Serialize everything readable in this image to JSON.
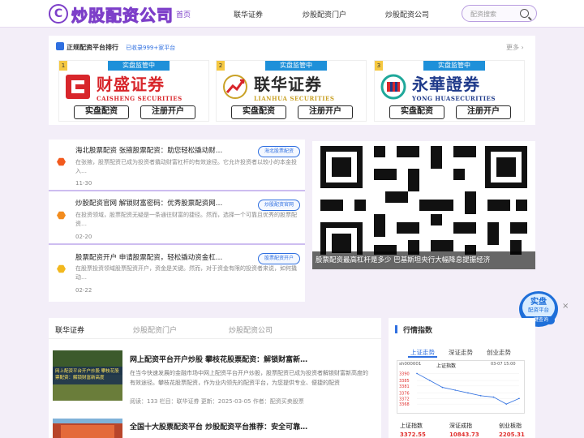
{
  "nav": {
    "logo_text": "炒股配资公司",
    "items": [
      "首页",
      "联华证券",
      "炒股配资门户",
      "炒股配资公司"
    ],
    "search_placeholder": "配资搜索"
  },
  "colors": {
    "accent": "#7d3fc9",
    "link": "#2f6fe0",
    "badge": "#1e90d9",
    "price_up": "#e0302e"
  },
  "rank": {
    "title": "正规配资平台排行",
    "subtitle": "已收录999+家平台",
    "more": "更多"
  },
  "cards": [
    {
      "num": "1",
      "tag": "实盘监管中",
      "name_cn": "财盛证券",
      "name_en": "CAISHENG SECURITIES",
      "btn1": "实盘配资",
      "btn2": "注册开户",
      "color": "#d8262b"
    },
    {
      "num": "2",
      "tag": "实盘监管中",
      "name_cn": "联华证券",
      "name_en": "LIANHUA SECURITIES",
      "btn1": "实盘配资",
      "btn2": "注册开户",
      "color": "#2a2a2a"
    },
    {
      "num": "3",
      "tag": "实盘监管中",
      "name_cn": "永華證券",
      "name_en": "YONG HUASECURITIES",
      "btn1": "实盘配资",
      "btn2": "注册开户",
      "color": "#1f3a8a"
    }
  ],
  "news": [
    {
      "title": "海北股票配资 张掖股票配资：助您轻松撬动财…",
      "desc": "在张掖，股票配资已成为投资者撬动财富杠杆的有效途径。它允许投资者以较小的本金投入…",
      "date": "11-30",
      "tag": "海北股票配资",
      "dot": "#f25a1e"
    },
    {
      "title": "炒股配资官网 解锁财富密码：优秀股票配资网…",
      "desc": "在投资领域，股票配资无疑是一条通往财富的捷径。然而，选择一个可靠且优秀的股票配资…",
      "date": "02-20",
      "tag": "炒股配资官网",
      "dot": "#f28c1e"
    },
    {
      "title": "股票配资开户 申请股票配资，轻松撬动资金杠…",
      "desc": "在股票投资领域股票配资开户，资金是关键。然而，对于资金有限的投资者来说，如何撬动…",
      "date": "02-22",
      "tag": "股票配资开户",
      "dot": "#f2b81e"
    }
  ],
  "qr_caption": "股票配资最高杠杆是多少 巴基斯坦央行大幅降息提振经济",
  "float_btn": {
    "line1": "实盘",
    "line2": "配资平台",
    "line3": "一键查询",
    "close": "×"
  },
  "tabs": [
    "联华证券",
    "炒股配资门户",
    "炒股配资公司"
  ],
  "articles": [
    {
      "title": "网上配资平台开户炒股 攀枝花股票配资：解锁财富新…",
      "desc": "在当今快速发展的金融市场中网上配资平台开户炒股，股票配资已成为投资者解锁财富新高度的有效途径。攀枝花股票配资，作为业内领先的配资平台，为您提供专业、便捷的配资",
      "meta": "阅读：133  栏目：联华证券  更新：2025-03-05  作者：配资买卖股票",
      "thumb_text": "网上配资平台开户炒股 攀枝花股票配资：解锁财富新高度"
    },
    {
      "title": "全国十大股票配资平台 炒股配资平台推荐：安全可靠…",
      "desc": "",
      "meta": "",
      "thumb_text": ""
    }
  ],
  "market": {
    "title": "行情指数",
    "tabs": [
      "上证走势",
      "深证走势",
      "创业走势"
    ],
    "chart_code": "sh000001",
    "chart_title": "上证指数",
    "chart_date": "03-07 15:00",
    "y_ticks": [
      "3390",
      "3385",
      "3381",
      "3376",
      "3372",
      "3368"
    ],
    "indices": [
      {
        "name": "上证指数",
        "value": "3372.55"
      },
      {
        "name": "深证成指",
        "value": "10843.73"
      },
      {
        "name": "创业板指",
        "value": "2205.31"
      }
    ]
  },
  "chart_data": {
    "type": "line",
    "title": "上证指数",
    "x": [
      "9:30",
      "10:00",
      "10:30",
      "11:00",
      "11:30",
      "13:30",
      "14:00",
      "14:30",
      "15:00"
    ],
    "series": [
      {
        "values": [
          3390,
          3385,
          3380,
          3378,
          3376,
          3374,
          3373,
          3368,
          3372
        ]
      }
    ],
    "ylim": [
      3364,
      3392
    ]
  }
}
